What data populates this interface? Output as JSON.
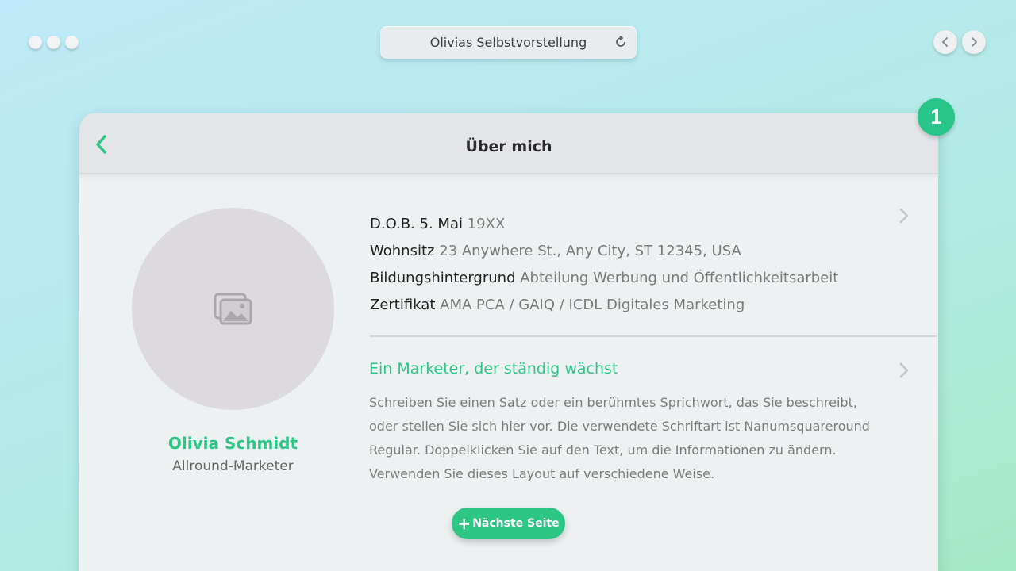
{
  "window": {
    "title": "Olivias Selbstvorstellung",
    "controls": [
      "window-dot",
      "window-dot",
      "window-dot"
    ],
    "nav_icons": [
      "chevron-left-icon",
      "chevron-right-icon"
    ],
    "reload_icon": "reload-icon"
  },
  "header": {
    "title": "Über mich",
    "back_icon": "chevron-left-icon"
  },
  "badge": {
    "number": "1"
  },
  "profile": {
    "photo_icon": "image-placeholder-icon",
    "name": "Olivia Schmidt",
    "role": "Allround-Marketer"
  },
  "info": [
    {
      "label": "D.O.B. 5. Mai",
      "value": "19XX"
    },
    {
      "label": "Wohnsitz",
      "value": "23 Anywhere St., Any City, ST 12345, USA"
    },
    {
      "label": "Bildungshintergrund",
      "value": "Abteilung Werbung und Öffentlichkeitsarbeit"
    },
    {
      "label": "Zertifikat",
      "value": "AMA PCA / GAIQ / ICDL Digitales Marketing"
    }
  ],
  "about": {
    "tagline": "Ein Marketer, der ständig wächst",
    "description": "Schreiben Sie einen Satz oder ein berühmtes Sprichwort, das Sie beschreibt, oder stellen Sie sich hier vor. Die verwendete Schriftart ist Nanumsquareround Regular. Doppelklicken Sie auf den Text, um die Informationen zu ändern. Verwenden Sie dieses Layout auf verschiedene Weise."
  },
  "next_button": {
    "icon": "+",
    "label": "Nächste Seite"
  },
  "colors": {
    "accent": "#2ec685",
    "badge": "#28c58a",
    "card": "#eef1f3"
  }
}
